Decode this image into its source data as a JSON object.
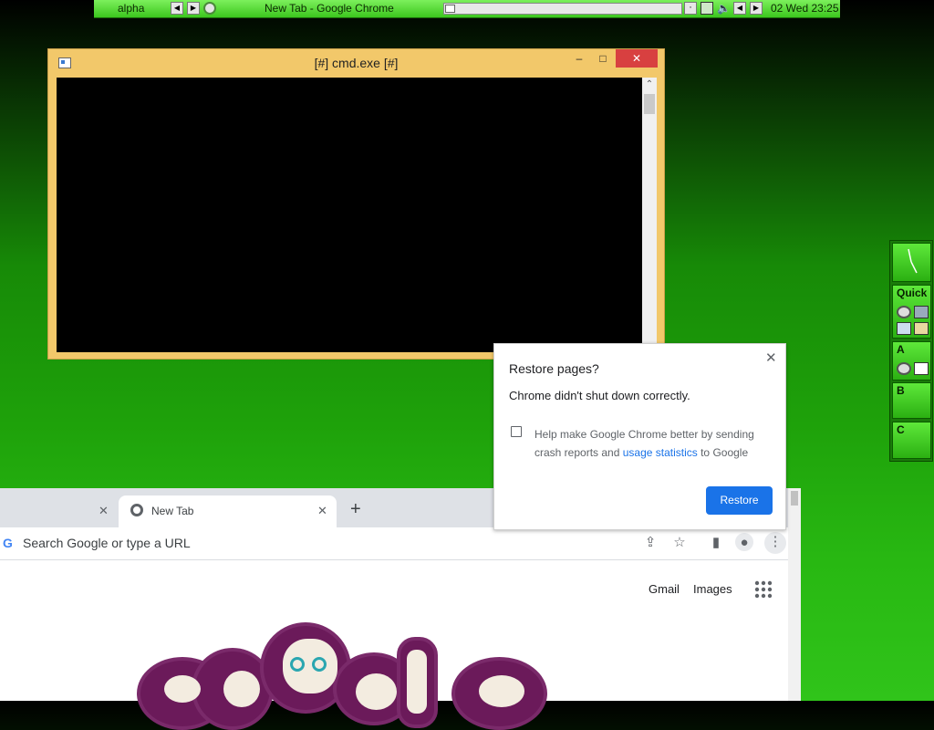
{
  "top_panel": {
    "workspace": "alpha",
    "window_title": "New Tab - Google Chrome",
    "clock": "02 Wed 23:25",
    "nav_prev": "◀",
    "nav_next": "▶"
  },
  "cmd_window": {
    "title": "[#] cmd.exe [#]",
    "minimize": "–",
    "maximize": "□",
    "close": "✕",
    "scroll_up": "⌃",
    "scroll_down": "⌄"
  },
  "dock": {
    "sections": [
      "Quick",
      "A",
      "B",
      "C"
    ]
  },
  "chrome": {
    "tabs": [
      {
        "label": ""
      },
      {
        "label": "New Tab"
      }
    ],
    "new_tab_symbol": "+",
    "tab_close_symbol": "✕",
    "omnibox_placeholder": "Search Google or type a URL",
    "omnibox_g": "G",
    "ntp_links": [
      "Gmail",
      "Images"
    ]
  },
  "restore_dialog": {
    "title": "Restore pages?",
    "message": "Chrome didn't shut down correctly.",
    "checkbox_text_1": "Help make Google Chrome better by sending",
    "checkbox_text_2a": "crash reports and ",
    "checkbox_link": "usage statistics",
    "checkbox_text_2b": " to Google",
    "close": "✕",
    "restore_button": "Restore"
  },
  "colors": {
    "panel_green": "#4ad62a",
    "cmd_frame": "#f2c86a",
    "close_red": "#d84040",
    "chrome_blue": "#1a73e8",
    "link_blue": "#1a73e8"
  }
}
